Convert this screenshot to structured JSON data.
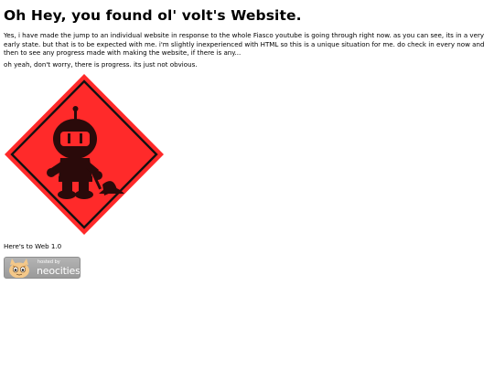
{
  "page": {
    "title": "Oh Hey, you found ol' volt's Website.",
    "intro": "Yes, i have made the jump to an individual website in response to the whole Fiasco youtube is going through right now. as you can see, its in a very early state. but that is to be expected with me. i'm slightly inexperienced with HTML so this is a unique situation for me. do check in every now and then to see any progress made with making the website, if there is any...",
    "note": "oh yeah, don't worry, there is progress. its just not obvious.",
    "footer_text": "Here's to Web 1.0"
  },
  "image": {
    "description_icon": "under-construction-sign-icon",
    "colors": {
      "sign_red": "#ff2a2a",
      "sign_border": "#111111",
      "figure": "#2a0a0a"
    }
  },
  "badge": {
    "hosted_label": "hosted by",
    "name": "neocities",
    "icon": "neocities-cat-icon",
    "colors": {
      "background": "#a8a8a8",
      "text": "#ffffff"
    }
  }
}
